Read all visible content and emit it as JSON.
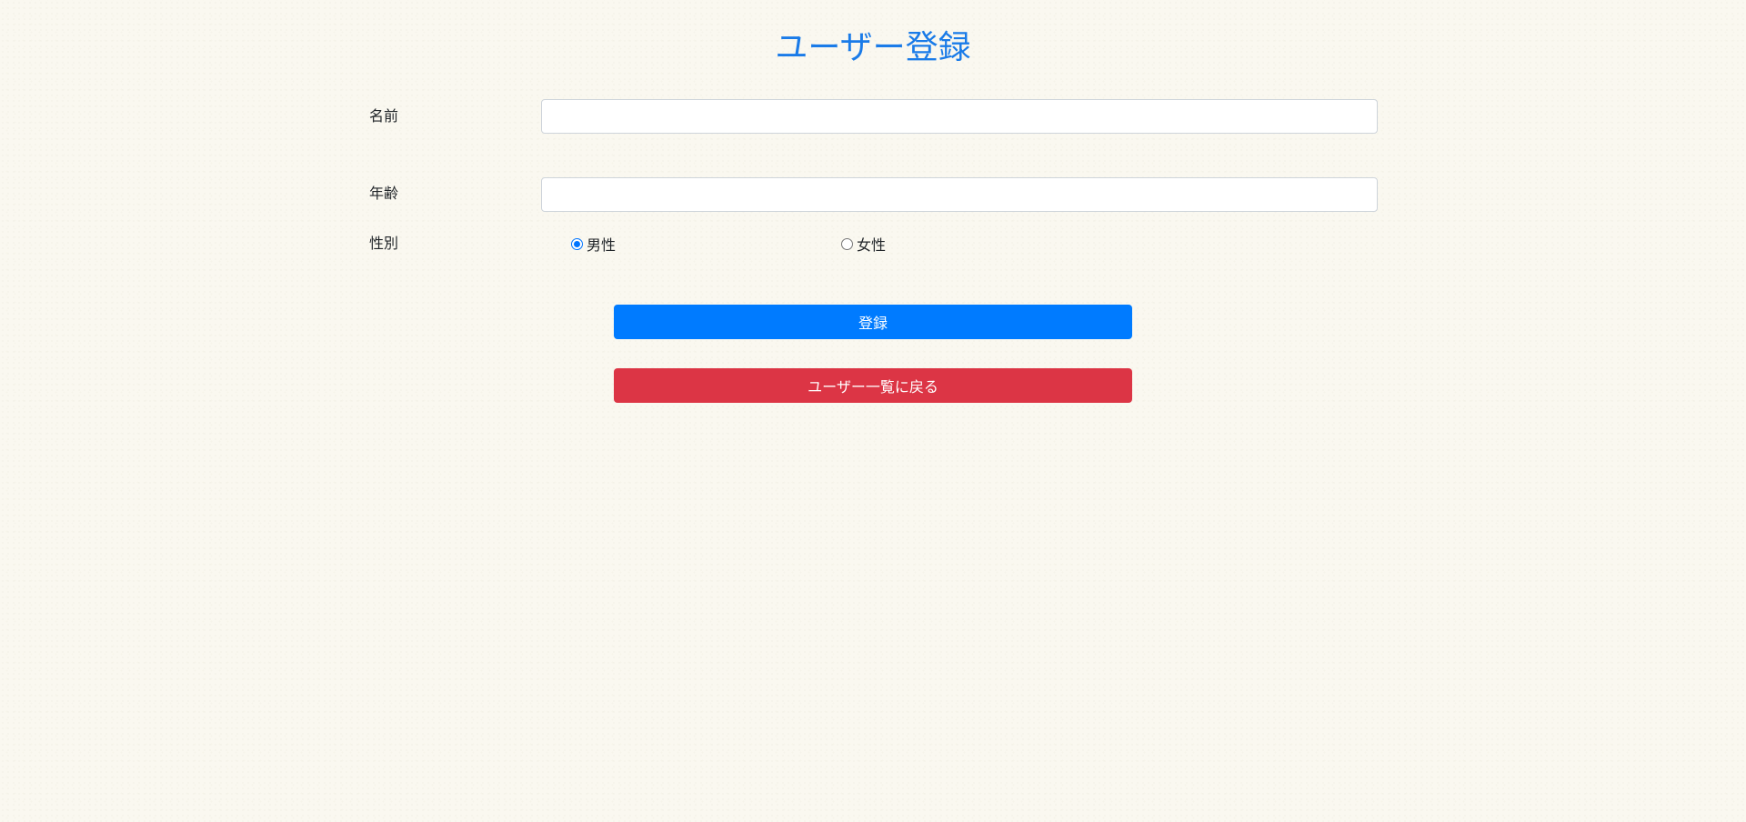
{
  "page": {
    "title": "ユーザー登録"
  },
  "form": {
    "name": {
      "label": "名前",
      "value": "",
      "placeholder": ""
    },
    "age": {
      "label": "年齢",
      "value": "",
      "placeholder": ""
    },
    "gender": {
      "label": "性別",
      "options": [
        {
          "label": "男性",
          "checked": true
        },
        {
          "label": "女性",
          "checked": false
        }
      ]
    }
  },
  "buttons": {
    "register_label": "登録",
    "back_label": "ユーザー一覧に戻る"
  },
  "colors": {
    "title": "#1a7be8",
    "primary": "#007bff",
    "danger": "#dc3545",
    "background": "#faf8f0"
  }
}
